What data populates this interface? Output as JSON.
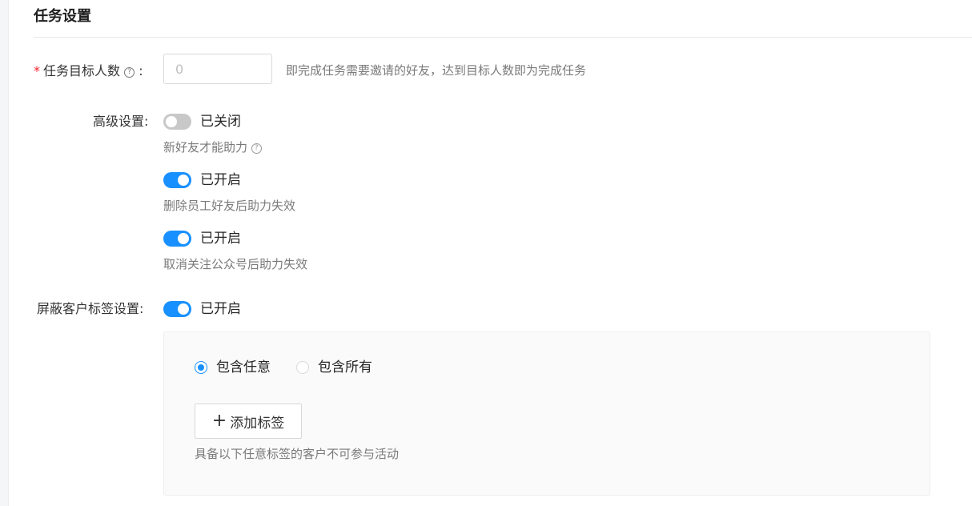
{
  "section": {
    "title": "任务设置"
  },
  "target_count": {
    "label": "任务目标人数",
    "colon": ":",
    "placeholder": "0",
    "hint": "即完成任务需要邀请的好友，达到目标人数即为完成任务"
  },
  "advanced": {
    "label": "高级设置:",
    "options": [
      {
        "status": "已关闭",
        "enabled": false,
        "description": "新好友才能助力"
      },
      {
        "status": "已开启",
        "enabled": true,
        "description": "删除员工好友后助力失效"
      },
      {
        "status": "已开启",
        "enabled": true,
        "description": "取消关注公众号后助力失效"
      }
    ]
  },
  "block_tags": {
    "label": "屏蔽客户标签设置:",
    "status": "已开启",
    "enabled": true,
    "radios": [
      {
        "label": "包含任意",
        "checked": true
      },
      {
        "label": "包含所有",
        "checked": false
      }
    ],
    "add_button_label": "添加标签",
    "hint": "具备以下任意标签的客户不可参与活动"
  },
  "icons": {
    "help": "question-circle-icon",
    "plus": "plus-icon"
  },
  "colors": {
    "accent": "#1890ff",
    "required": "#f5222d",
    "switch_off": "#c8c8c8"
  }
}
